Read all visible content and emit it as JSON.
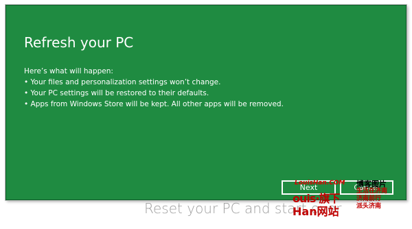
{
  "dialog": {
    "title": "Refresh your PC",
    "intro": "Here’s what will happen:",
    "bullets": [
      "• Your files and personalization settings won’t change.",
      "• Your PC settings will be restored to their defaults.",
      "• Apps from Windows Store will be kept. All other apps will be removed."
    ],
    "next_label": "Next",
    "cancel_label": "Cancel"
  },
  "background": {
    "below_text": "Reset your PC and start over"
  },
  "watermarks": {
    "top": "互联网的一些事",
    "site_red": "LouisHan.COM",
    "blog": "博客图片",
    "logo_line1": "ouis·旗下",
    "logo_line2": "Han网站",
    "right_lines": [
      "生活在济南",
      "济南前行",
      "派头济南"
    ]
  },
  "colors": {
    "green": "#1f8b41",
    "white": "#ffffff"
  }
}
